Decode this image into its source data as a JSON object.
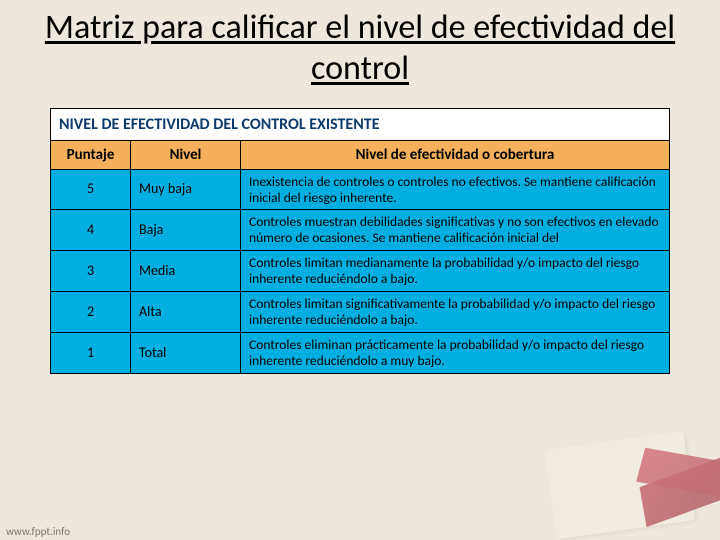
{
  "title": "Matriz para calificar el nivel de efectividad del control",
  "table": {
    "main_header": "NIVEL DE EFECTIVIDAD DEL CONTROL EXISTENTE",
    "cols": {
      "score": "Puntaje",
      "level": "Nivel",
      "desc": "Nivel de efectividad o cobertura"
    },
    "rows": [
      {
        "score": "5",
        "level": "Muy baja",
        "desc": "Inexistencia de controles o controles no efectivos. Se mantiene calificación inicial del riesgo inherente."
      },
      {
        "score": "4",
        "level": "Baja",
        "desc": "Controles muestran debilidades significativas y no son efectivos en elevado número de ocasiones. Se mantiene calificación inicial del"
      },
      {
        "score": "3",
        "level": "Media",
        "desc": "Controles limitan medianamente la probabilidad y/o impacto del riesgo inherente reduciéndolo a bajo."
      },
      {
        "score": "2",
        "level": "Alta",
        "desc": "Controles limitan significativamente la probabilidad y/o impacto del riesgo inherente reduciéndolo a bajo."
      },
      {
        "score": "1",
        "level": "Total",
        "desc": "Controles eliminan prácticamente la probabilidad y/o impacto del riesgo inherente reduciéndolo a muy bajo."
      }
    ]
  },
  "footer": "www.fppt.info"
}
